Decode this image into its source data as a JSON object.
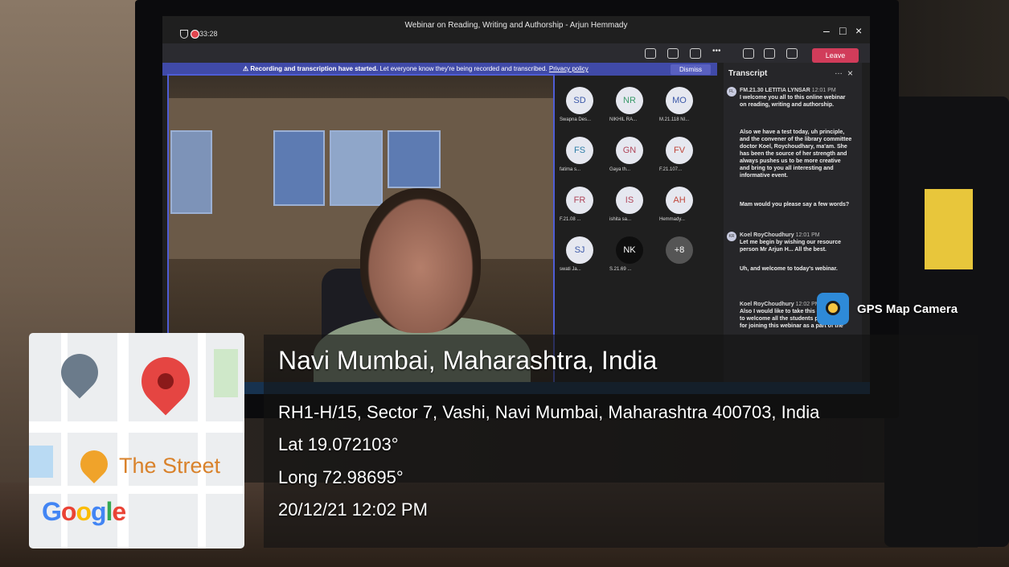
{
  "window": {
    "title": "Webinar on Reading, Writing and Authorship - Arjun Hemmady",
    "timer": "33:28"
  },
  "toolbar": {
    "leave_label": "Leave"
  },
  "banner": {
    "text": "Recording and transcription have started.",
    "subtext": "Let everyone know they're being recorded and transcribed.",
    "link": "Privacy policy",
    "dismiss": "Dismiss"
  },
  "participants": [
    {
      "initials": "SD",
      "name": "Swapna Des...",
      "color": "#3b58a8"
    },
    {
      "initials": "NR",
      "name": "NIKHIL RA...",
      "color": "#3a9a6a"
    },
    {
      "initials": "MO",
      "name": "M.21.118 NI...",
      "color": "#3b58a8"
    },
    {
      "initials": "FS",
      "name": "fatima s...",
      "color": "#2f7fa8"
    },
    {
      "initials": "GN",
      "name": "Gaya th...",
      "color": "#b0465a"
    },
    {
      "initials": "FV",
      "name": "F.21.107...",
      "color": "#c0463a"
    },
    {
      "initials": "FR",
      "name": "F.21.08 ...",
      "color": "#b0465a"
    },
    {
      "initials": "IS",
      "name": "ishita sa...",
      "color": "#b0465a"
    },
    {
      "initials": "AH",
      "name": "Hemmady...",
      "color": "#c0463a"
    },
    {
      "initials": "SJ",
      "name": "swati Ja...",
      "color": "#3b58a8"
    },
    {
      "initials": "NK",
      "name": "S.21.69 ...",
      "color": "#ffffff"
    },
    {
      "initials": "+8",
      "name": "",
      "color": "#ffffff"
    }
  ],
  "transcript": {
    "title": "Transcript",
    "entries": [
      {
        "initials": "FL",
        "speaker": "FM.21.30 LETITIA LYNSAR",
        "time": "12:01 PM",
        "text": "I welcome you all to this online webinar on reading, writing and authorship."
      },
      {
        "initials": "",
        "speaker": "",
        "time": "",
        "text": "Also we have a test today, uh principle, and the convener of the library committee doctor Koel, Roychoudhary, ma'am. She has been the source of her strength and always pushes us to be more creative and bring to you all interesting and informative event."
      },
      {
        "initials": "",
        "speaker": "",
        "time": "",
        "text": "Mam would you please say a few words?"
      },
      {
        "initials": "KR",
        "speaker": "Koel RoyChoudhury",
        "time": "12:01 PM",
        "text": "Let me begin by wishing our resource person Mr Arjun H... All the best."
      },
      {
        "initials": "",
        "speaker": "",
        "time": "",
        "text": "Uh, and welcome to today's webinar."
      },
      {
        "initials": "",
        "speaker": "Koel RoyChoudhury",
        "time": "12:02 PM",
        "text": "Also I would like to take this opportunity to welcome all the students participants for joining this webinar as a part of the"
      }
    ]
  },
  "map": {
    "poi_label": "The Street",
    "brand": "Google"
  },
  "gps": {
    "app_name": "GPS Map Camera",
    "city": "Navi Mumbai, Maharashtra, India",
    "address": "RH1-H/15, Sector 7, Vashi, Navi Mumbai, Maharashtra 400703, India",
    "lat": "Lat 19.072103°",
    "long": "Long 72.98695°",
    "datetime": "20/12/21 12:02 PM"
  },
  "colors": {
    "accent": "#4f5dd6",
    "leave": "#d13c5a",
    "map_pin": "#e54542",
    "map_poi": "#f0a32a"
  }
}
